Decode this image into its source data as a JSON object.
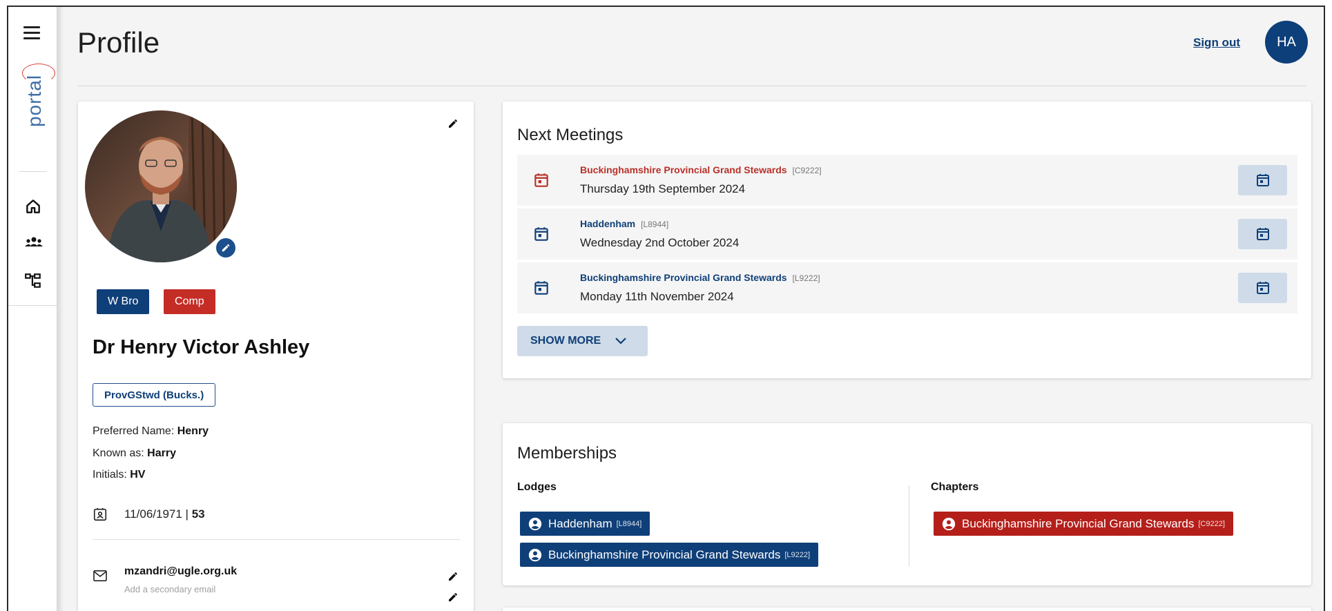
{
  "app": {
    "brand": "portal",
    "page_title": "Profile",
    "sign_out_label": "Sign out",
    "user_initials": "HA",
    "colors": {
      "primary": "#0f3f78",
      "danger": "#c42d26",
      "accent_soft": "#cfdbe8"
    }
  },
  "sidebar": {
    "icons": [
      "menu-icon",
      "home-icon",
      "people-icon",
      "org-tree-icon"
    ]
  },
  "profile": {
    "honorifics": [
      {
        "label": "W Bro",
        "color": "#0f3f78"
      },
      {
        "label": "Comp",
        "color": "#c42d26"
      }
    ],
    "full_name": "Dr Henry Victor Ashley",
    "rank": "ProvGStwd (Bucks.)",
    "preferred_name_label": "Preferred Name:",
    "preferred_name": "Henry",
    "known_as_label": "Known as:",
    "known_as": "Harry",
    "initials_label": "Initials:",
    "initials": "HV",
    "dob": "11/06/1971",
    "dob_separator": " | ",
    "age": "53",
    "email": "mzandri@ugle.org.uk",
    "secondary_email_placeholder": "Add a secondary email"
  },
  "meetings": {
    "title": "Next Meetings",
    "items": [
      {
        "name": "Buckinghamshire Provincial Grand Stewards",
        "code": "[C9222]",
        "date": "Thursday 19th September 2024",
        "color": "#b83028"
      },
      {
        "name": "Haddenham",
        "code": "[L8944]",
        "date": "Wednesday 2nd October 2024",
        "color": "#0f3f78"
      },
      {
        "name": "Buckinghamshire Provincial Grand Stewards",
        "code": "[L9222]",
        "date": "Monday 11th November 2024",
        "color": "#0f3f78"
      }
    ],
    "show_more_label": "SHOW MORE"
  },
  "memberships": {
    "title": "Memberships",
    "lodges_label": "Lodges",
    "chapters_label": "Chapters",
    "lodges": [
      {
        "name": "Haddenham",
        "code": "[L8944]"
      },
      {
        "name": "Buckinghamshire Provincial Grand Stewards",
        "code": "[L9222]"
      }
    ],
    "chapters": [
      {
        "name": "Buckinghamshire Provincial Grand Stewards",
        "code": "[C9222]"
      }
    ]
  }
}
